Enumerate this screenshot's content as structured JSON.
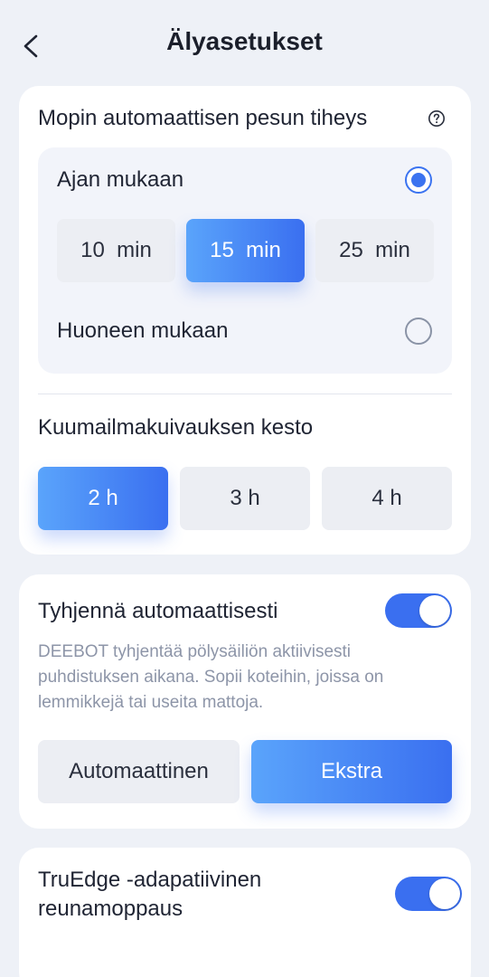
{
  "header": {
    "title": "Älyasetukset"
  },
  "mop_wash": {
    "title": "Mopin automaattisen pesun tiheys",
    "by_time": {
      "label": "Ajan mukaan",
      "selected": true
    },
    "intervals": [
      "10  min",
      "15  min",
      "25  min"
    ],
    "selected_interval": "15  min",
    "by_room": {
      "label": "Huoneen mukaan",
      "selected": false
    }
  },
  "hot_air_drying": {
    "title": "Kuumailmakuivauksen kesto",
    "options": [
      "2 h",
      "3 h",
      "4 h"
    ],
    "selected": "2 h"
  },
  "auto_empty": {
    "title": "Tyhjennä automaattisesti",
    "enabled": true,
    "description": "DEEBOT tyhjentää pölysäiliön aktiivisesti puhdistuksen aikana. Sopii koteihin, joissa on lemmikkejä tai useita mattoja.",
    "modes": [
      "Automaattinen",
      "Ekstra"
    ],
    "selected_mode": "Ekstra"
  },
  "truedge": {
    "title_line1": "TruEdge -adapatiivinen",
    "title_line2": "reunamoppaus",
    "enabled": true
  },
  "colors": {
    "accent": "#3a6ff0",
    "accent_light": "#5aa4fb",
    "page_bg": "#eef1f7"
  }
}
